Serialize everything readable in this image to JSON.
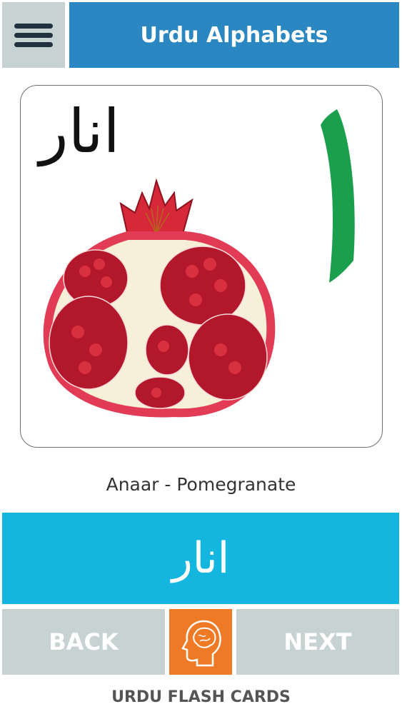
{
  "header": {
    "title": "Urdu Alphabets",
    "menu_icon": "hamburger-menu-icon"
  },
  "card": {
    "urdu_word": "انار",
    "letter": "ا",
    "image": "pomegranate-illustration"
  },
  "caption": "Anaar - Pomegranate",
  "word_banner": {
    "text": "انار"
  },
  "nav": {
    "back_label": "BACK",
    "next_label": "NEXT",
    "center_icon": "brain-head-icon"
  },
  "footer": "URDU FLASH CARDS",
  "colors": {
    "header_blue": "#2a87c2",
    "banner_cyan": "#14b6e0",
    "button_gray": "#c7d2d3",
    "accent_orange": "#ef7a26",
    "letter_green": "#1aa04c"
  }
}
